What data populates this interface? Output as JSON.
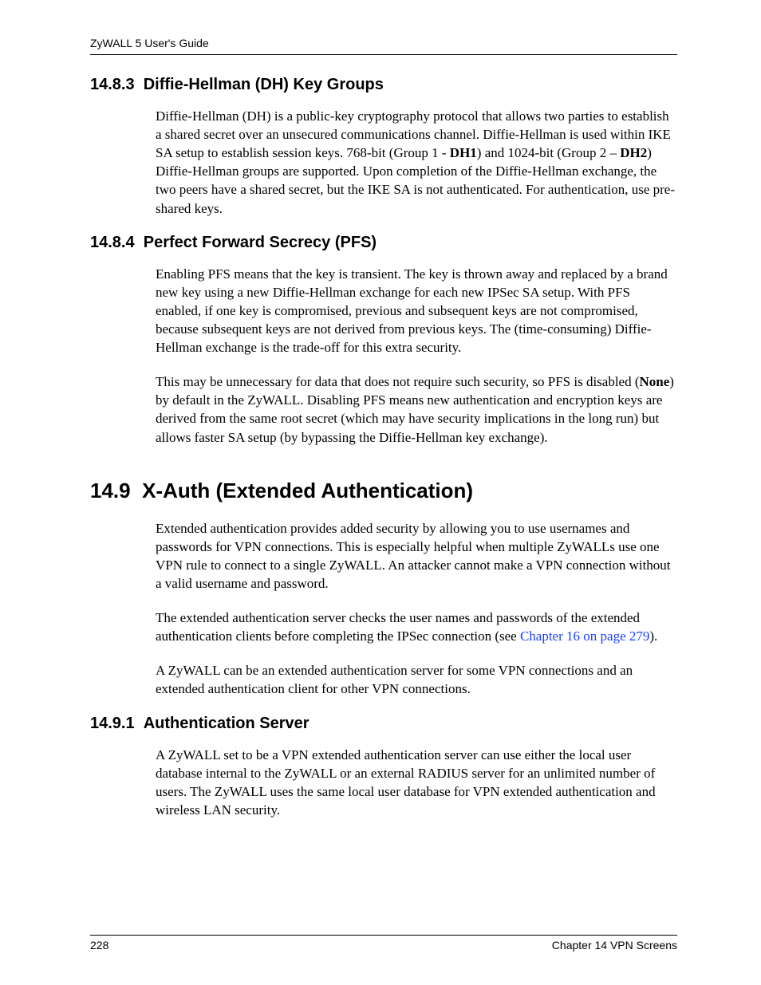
{
  "header": {
    "running_head": "ZyWALL 5 User's Guide"
  },
  "sections": {
    "s1483": {
      "number": "14.8.3",
      "title": "Diffie-Hellman (DH) Key Groups",
      "p1_a": "Diffie-Hellman (DH) is a public-key cryptography protocol that allows two parties to establish a shared secret over an unsecured communications channel. Diffie-Hellman is used within IKE SA setup to establish session keys. 768-bit (Group 1 - ",
      "p1_b1": "DH1",
      "p1_c": ") and 1024-bit (Group 2 – ",
      "p1_b2": "DH2",
      "p1_d": ") Diffie-Hellman groups are supported. Upon completion of the Diffie-Hellman exchange, the two peers have a shared secret, but the IKE SA is not authenticated. For authentication, use pre-shared keys."
    },
    "s1484": {
      "number": "14.8.4",
      "title": "Perfect Forward Secrecy (PFS)",
      "p1": "Enabling PFS means that the key is transient. The key is thrown away and replaced by a brand new key using a new Diffie-Hellman exchange for each new IPSec SA setup. With PFS enabled, if one key is compromised, previous and subsequent keys are not compromised, because subsequent keys are not derived from previous keys. The (time-consuming) Diffie-Hellman exchange is the trade-off for this extra security.",
      "p2_a": "This may be unnecessary for data that does not require such security, so PFS is disabled (",
      "p2_b": "None",
      "p2_c": ") by default in the ZyWALL. Disabling PFS means new authentication and encryption keys are derived from the same root secret (which may have security implications in the long run) but allows faster SA setup (by bypassing the Diffie-Hellman key exchange)."
    },
    "s149": {
      "number": "14.9",
      "title": "X-Auth (Extended Authentication)",
      "p1": "Extended authentication provides added security by allowing you to use usernames and passwords for VPN connections. This is especially helpful when multiple ZyWALLs use one VPN rule to connect to a single ZyWALL. An attacker cannot make a VPN connection without a valid username and password.",
      "p2_a": "The extended authentication server checks the user names and passwords of the extended authentication clients before completing the IPSec connection (see ",
      "p2_link": "Chapter 16 on page 279",
      "p2_b": ").",
      "p3": "A ZyWALL can be an extended authentication server for some VPN connections and an extended authentication client for other VPN connections."
    },
    "s1491": {
      "number": "14.9.1",
      "title": "Authentication Server",
      "p1": "A ZyWALL set to be a VPN extended authentication server can use either the local user database internal to the ZyWALL or an external RADIUS server for an unlimited number of users. The ZyWALL uses the same local user database for VPN extended authentication and wireless LAN security."
    }
  },
  "footer": {
    "page_number": "228",
    "chapter": "Chapter 14 VPN Screens"
  }
}
